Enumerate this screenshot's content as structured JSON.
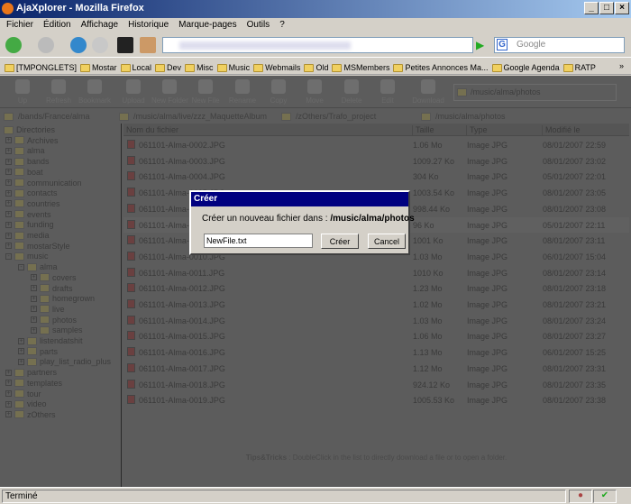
{
  "window": {
    "title": "AjaXplorer - Mozilla Firefox",
    "min": "_",
    "max": "□",
    "close": "×"
  },
  "menu": [
    "Fichier",
    "Édition",
    "Affichage",
    "Historique",
    "Marque-pages",
    "Outils",
    "?"
  ],
  "search": {
    "placeholder": "Google",
    "engine": "G"
  },
  "bookmarks": [
    "[TMPONGLETS]",
    "Mostar",
    "Local",
    "Dev",
    "Misc",
    "Music",
    "Webmails",
    "Old",
    "MSMembers",
    "Petites Annonces Ma...",
    "Google Agenda",
    "RATP"
  ],
  "bookmarks_more": "»",
  "toolbar": [
    "Up",
    "Refresh",
    "Bookmark",
    "Upload",
    "New Folder",
    "New File",
    "Rename",
    "Copy",
    "Move",
    "Delete",
    "Edit",
    "Download"
  ],
  "current_path": "/music/alma/photos",
  "bookmarked_paths": [
    "/bands/France/alma",
    "/music/alma/live/zzz_MaquetteAlbum",
    "/zOthers/Trafo_project",
    "/music/alma/photos"
  ],
  "tree": [
    {
      "label": "Directories",
      "level": 0,
      "pm": ""
    },
    {
      "label": "Archives",
      "level": 1,
      "pm": "+"
    },
    {
      "label": "alma",
      "level": 1,
      "pm": "+"
    },
    {
      "label": "bands",
      "level": 1,
      "pm": "+"
    },
    {
      "label": "boat",
      "level": 1,
      "pm": "+"
    },
    {
      "label": "communication",
      "level": 1,
      "pm": "+"
    },
    {
      "label": "contacts",
      "level": 1,
      "pm": "+"
    },
    {
      "label": "countries",
      "level": 1,
      "pm": "+"
    },
    {
      "label": "events",
      "level": 1,
      "pm": "+"
    },
    {
      "label": "funding",
      "level": 1,
      "pm": "+"
    },
    {
      "label": "media",
      "level": 1,
      "pm": "+"
    },
    {
      "label": "mostarStyle",
      "level": 1,
      "pm": "+"
    },
    {
      "label": "music",
      "level": 1,
      "pm": "-"
    },
    {
      "label": "alma",
      "level": 2,
      "pm": "-"
    },
    {
      "label": "covers",
      "level": 3,
      "pm": "+"
    },
    {
      "label": "drafts",
      "level": 3,
      "pm": "+"
    },
    {
      "label": "homegrown",
      "level": 3,
      "pm": "+"
    },
    {
      "label": "live",
      "level": 3,
      "pm": "+"
    },
    {
      "label": "photos",
      "level": 3,
      "pm": "+"
    },
    {
      "label": "samples",
      "level": 3,
      "pm": "+"
    },
    {
      "label": "listendatshit",
      "level": 2,
      "pm": "+"
    },
    {
      "label": "parts",
      "level": 2,
      "pm": "+"
    },
    {
      "label": "play_list_radio_plus",
      "level": 2,
      "pm": "+"
    },
    {
      "label": "partners",
      "level": 1,
      "pm": "+"
    },
    {
      "label": "templates",
      "level": 1,
      "pm": "+"
    },
    {
      "label": "tour",
      "level": 1,
      "pm": "+"
    },
    {
      "label": "video",
      "level": 1,
      "pm": "+"
    },
    {
      "label": "zOthers",
      "level": 1,
      "pm": "+"
    }
  ],
  "columns": [
    "Nom du fichier",
    "Taille",
    "Type",
    "Modifié le"
  ],
  "files": [
    [
      "061101-Alma-0002.JPG",
      "1.06 Mo",
      "Image JPG",
      "08/01/2007 22:59"
    ],
    [
      "061101-Alma-0003.JPG",
      "1009.27 Ko",
      "Image JPG",
      "08/01/2007 23:02"
    ],
    [
      "061101-Alma-0004.JPG",
      "304 Ko",
      "Image JPG",
      "05/01/2007 22:01"
    ],
    [
      "061101-Alma-0005.JPG",
      "1003.54 Ko",
      "Image JPG",
      "08/01/2007 23:05"
    ],
    [
      "061101-Alma-0006.JPG",
      "998.44 Ko",
      "Image JPG",
      "08/01/2007 23:08"
    ],
    [
      "061101-Alma-0007.JPG",
      "96 Ko",
      "Image JPG",
      "05/01/2007 22:11"
    ],
    [
      "061101-Alma-0008.JPG",
      "1001 Ko",
      "Image JPG",
      "08/01/2007 23:11"
    ],
    [
      "061101-Alma-0010.JPG",
      "1.03 Mo",
      "Image JPG",
      "06/01/2007 15:04"
    ],
    [
      "061101-Alma-0011.JPG",
      "1010 Ko",
      "Image JPG",
      "08/01/2007 23:14"
    ],
    [
      "061101-Alma-0012.JPG",
      "1.23 Mo",
      "Image JPG",
      "08/01/2007 23:18"
    ],
    [
      "061101-Alma-0013.JPG",
      "1.02 Mo",
      "Image JPG",
      "08/01/2007 23:21"
    ],
    [
      "061101-Alma-0014.JPG",
      "1.03 Mo",
      "Image JPG",
      "08/01/2007 23:24"
    ],
    [
      "061101-Alma-0015.JPG",
      "1.06 Mo",
      "Image JPG",
      "08/01/2007 23:27"
    ],
    [
      "061101-Alma-0016.JPG",
      "1.13 Mo",
      "Image JPG",
      "06/01/2007 15:25"
    ],
    [
      "061101-Alma-0017.JPG",
      "1.12 Mo",
      "Image JPG",
      "08/01/2007 23:31"
    ],
    [
      "061101-Alma-0018.JPG",
      "924.12 Ko",
      "Image JPG",
      "08/01/2007 23:35"
    ],
    [
      "061101-Alma-0019.JPG",
      "1005.53 Ko",
      "Image JPG",
      "08/01/2007 23:38"
    ]
  ],
  "selected_row": 5,
  "tips": {
    "label": "Tips&Tricks",
    "text": " : DoubleClick in the list to directly download a file or to open a folder."
  },
  "dialog": {
    "title": "Créer",
    "message": "Créer un nouveau fichier dans : ",
    "path": "/music/alma/photos",
    "input_value": "NewFile.txt",
    "ok": "Créer",
    "cancel": "Cancel"
  },
  "status": {
    "text": "Terminé"
  }
}
